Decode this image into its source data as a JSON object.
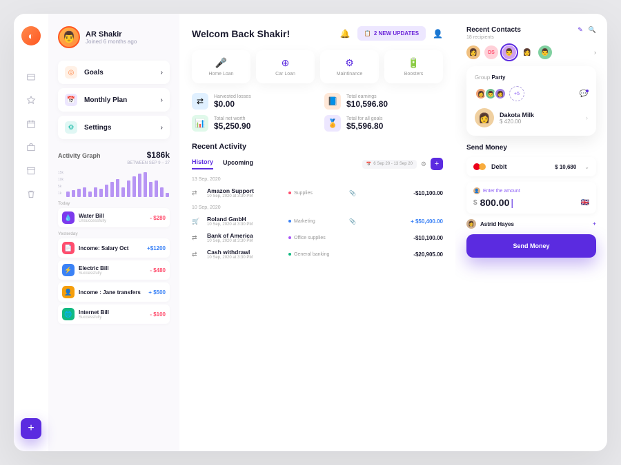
{
  "profile": {
    "name": "AR Shakir",
    "joined": "Joined 6 months ago"
  },
  "nav": {
    "goals": "Goals",
    "monthly": "Monthly Plan",
    "settings": "Settings"
  },
  "activity_graph": {
    "title": "Activity Graph",
    "value": "$186k",
    "range": "BETWEEN SEP 9 – 27",
    "bars": [
      8,
      10,
      12,
      14,
      8,
      14,
      12,
      18,
      22,
      26,
      14,
      24,
      30,
      34,
      36,
      22,
      24,
      14,
      6
    ]
  },
  "txn_groups": [
    {
      "label": "Today",
      "items": [
        {
          "icon": "💧",
          "color": "#7c3aed",
          "title": "Water Bill",
          "sub": "Unsuccessfully",
          "amt": "- $280",
          "cls": "amt-neg"
        }
      ]
    },
    {
      "label": "Yesterday",
      "items": [
        {
          "icon": "📄",
          "color": "#ff4d6d",
          "title": "Income: Salary Oct",
          "sub": "",
          "amt": "+$1200",
          "cls": "amt-pos"
        },
        {
          "icon": "⚡",
          "color": "#3b82f6",
          "title": "Electric Bill",
          "sub": "Successfully",
          "amt": "- $480",
          "cls": "amt-neg"
        },
        {
          "icon": "👤",
          "color": "#f59e0b",
          "title": "Income : Jane transfers",
          "sub": "",
          "amt": "+ $500",
          "cls": "amt-pos"
        },
        {
          "icon": "🌐",
          "color": "#10b981",
          "title": "Internet Bill",
          "sub": "Successfully",
          "amt": "- $100",
          "cls": "amt-neg"
        }
      ]
    }
  ],
  "welcome": "Welcom Back Shakir!",
  "updates": {
    "icon": "📋",
    "text": "2 NEW UPDATES"
  },
  "categories": [
    {
      "icon": "🎤",
      "label": "Home Loan",
      "color": "#ff4d6d"
    },
    {
      "icon": "⊕",
      "label": "Car Loan",
      "color": "#5b2be0"
    },
    {
      "icon": "⚙",
      "label": "Maintinance",
      "color": "#5b2be0"
    },
    {
      "icon": "🔋",
      "label": "Boosters",
      "color": "#ff4d6d"
    }
  ],
  "stats": [
    {
      "icon": "⇄",
      "bg": "#e0f0ff",
      "label": "Harvested losses",
      "value": "$0.00"
    },
    {
      "icon": "📘",
      "bg": "#ffe8d8",
      "label": "Total earnings",
      "value": "$10,596.80"
    },
    {
      "icon": "📊",
      "bg": "#e0f9ea",
      "label": "Total net worth",
      "value": "$5,250.90"
    },
    {
      "icon": "🏅",
      "bg": "#ede7ff",
      "label": "Total for all goals",
      "value": "$5,596.80"
    }
  ],
  "recent_activity": {
    "title": "Recent Activity",
    "tabs": {
      "history": "History",
      "upcoming": "Upcoming"
    },
    "date_range": "6 Sep 20 - 13 Sep 20"
  },
  "activities": [
    {
      "day": "13 Sep, 2020",
      "rows": [
        {
          "icon": "⇄",
          "name": "Amazon Support",
          "time": "10 Sep, 2020 at 3:30 PM",
          "dot": "#ff4d6d",
          "tag": "Supplies",
          "attach": true,
          "amt": "-$10,100.00",
          "cls": "amt-neg",
          "normal": true
        }
      ]
    },
    {
      "day": "10 Sep, 2020",
      "rows": [
        {
          "icon": "🛒",
          "name": "Roland GmbH",
          "time": "10 Sep, 2020 at 3:30 PM",
          "dot": "#3b82f6",
          "tag": "Marketing",
          "attach": true,
          "amt": "+ $50,400.00",
          "cls": "amt-pos"
        },
        {
          "icon": "⇄",
          "name": "Bank of America",
          "time": "10 Sep, 2020 at 3:30 PM",
          "dot": "#a855f7",
          "tag": "Office supplies",
          "attach": false,
          "amt": "-$10,100.00",
          "cls": "amt-neg",
          "normal": true
        },
        {
          "icon": "⇄",
          "name": "Cash withdrawl",
          "time": "10 Sep, 2020 at 3:30 PM",
          "dot": "#10b981",
          "tag": "General banking",
          "attach": false,
          "amt": "-$20,905.00",
          "cls": "amt-neg",
          "normal": true
        }
      ]
    }
  ],
  "contacts": {
    "title": "Recent Contacts",
    "sub": "18 recipients",
    "avatars": [
      "👩",
      "DS",
      "👨",
      "👩",
      "👨"
    ]
  },
  "group": {
    "label": "Group",
    "name": "Party",
    "more": "+5",
    "person_name": "Dakota Milk",
    "person_amt": "$ 420.00"
  },
  "send": {
    "title": "Send Money",
    "card_type": "Debit",
    "card_amt": "$ 10,680",
    "enter_label": "Enter the amount",
    "amount": "800.00",
    "recipient": "Astrid Hayes",
    "button": "Send Money"
  }
}
